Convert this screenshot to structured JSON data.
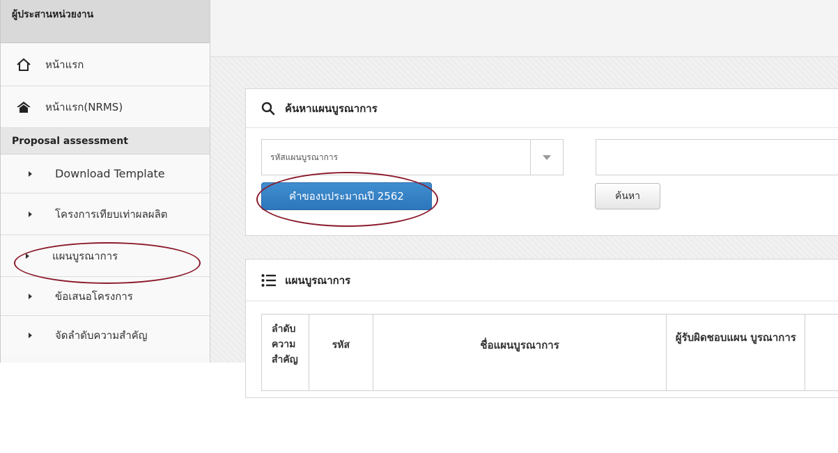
{
  "sidebar": {
    "title": "ผู้ประสานหน่วยงาน",
    "home": [
      {
        "label": "หน้าแรก",
        "icon": "home-outline-icon"
      },
      {
        "label": "หน้าแรก(NRMS)",
        "icon": "home-filled-icon"
      }
    ],
    "section": "Proposal assessment",
    "items": [
      {
        "label": "Download Template",
        "icon": "caret-right-icon"
      },
      {
        "label": "โครงการเทียบเท่าผลผลิต",
        "icon": "caret-right-icon"
      },
      {
        "label": "แผนบูรณาการ",
        "icon": "caret-right-icon"
      },
      {
        "label": "ข้อเสนอโครงการ",
        "icon": "caret-right-icon"
      },
      {
        "label": "จัดลำดับความสำคัญ",
        "icon": "caret-right-icon"
      }
    ]
  },
  "search_panel": {
    "title": "ค้นหาแผนบูรณาการ",
    "select_value": "รหัสแผนบูรณาการ",
    "text_value": "",
    "budget_button": "คำของบประมาณปี 2562",
    "search_button": "ค้นหา"
  },
  "plan_panel": {
    "title": "แผนบูรณาการ",
    "columns": [
      "ลำดับ ความ สำคัญ",
      "รหัส",
      "ชื่อแผนบูรณาการ",
      "ผู้รับผิดชอบแผน บูรณาการ"
    ]
  },
  "colors": {
    "primary_button": "#337ab7",
    "highlight_ring": "#8b1a2b",
    "sidebar_bg": "#f7f7f7"
  }
}
